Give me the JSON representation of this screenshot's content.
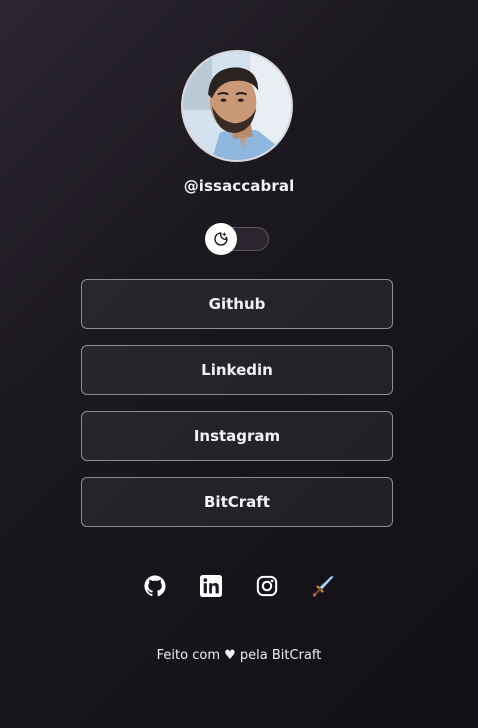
{
  "profile": {
    "username": "@issaccabral",
    "avatar_icon": "profile-photo"
  },
  "theme_toggle": {
    "state": "dark",
    "icon": "moon-stars-icon"
  },
  "links": [
    {
      "label": "Github"
    },
    {
      "label": "Linkedin"
    },
    {
      "label": "Instagram"
    },
    {
      "label": "BitCraft"
    }
  ],
  "social_icons": [
    "github-icon",
    "linkedin-icon",
    "instagram-icon",
    "sword-icon"
  ],
  "footer": {
    "prefix": "Feito com",
    "heart": "♥",
    "suffix": "pela BitCraft"
  },
  "colors": {
    "background": "#1c1820",
    "button_border": "#8f8b95",
    "text": "#ffffff"
  }
}
